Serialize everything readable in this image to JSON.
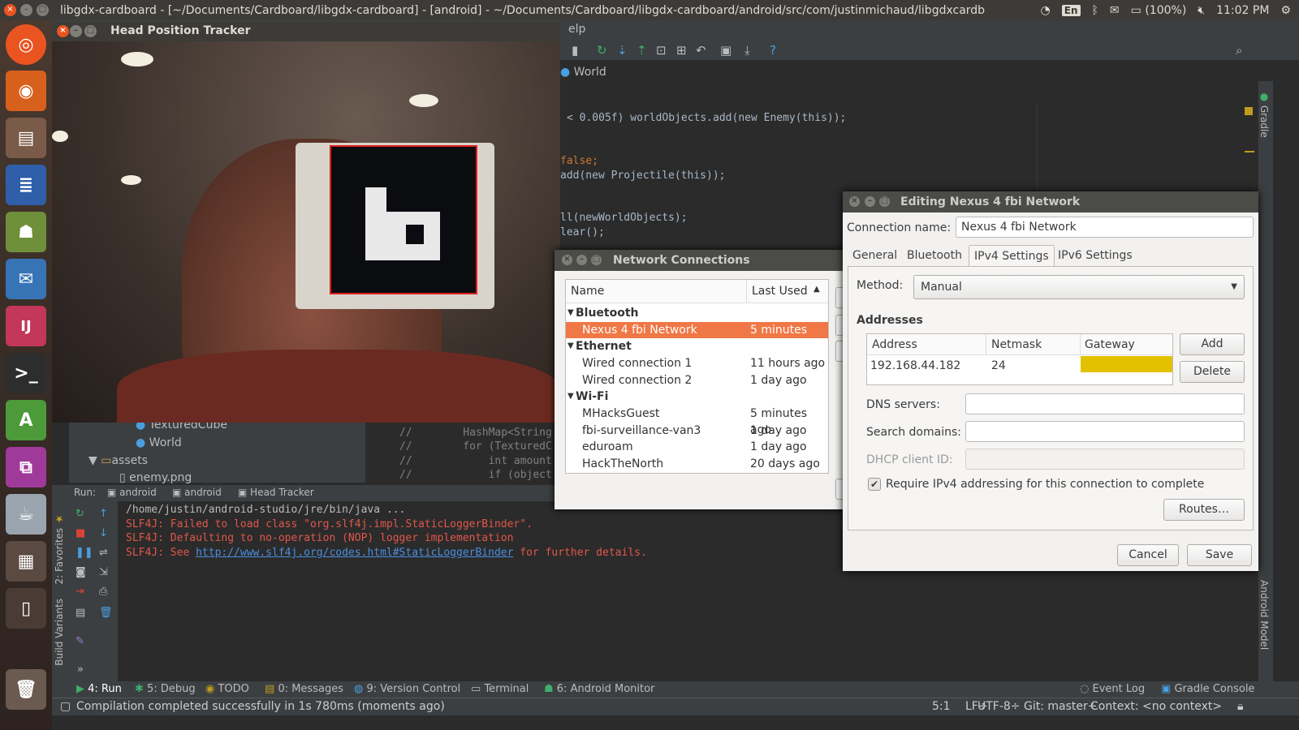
{
  "top_panel": {
    "title": "libgdx-cardboard - [~/Documents/Cardboard/libgdx-cardboard] - [android] - ~/Documents/Cardboard/libgdx-cardboard/android/src/com/justinmichaud/libgdxcardb",
    "lang": "En",
    "battery": "(100%)",
    "time": "11:02 PM"
  },
  "ide": {
    "menu_help": "elp",
    "breadcrumb": "World",
    "code_lines": [
      "< 0.005f) worldObjects.add(new Enemy(this));",
      "false;",
      "add(new Projectile(this));",
      "ll(newWorldObjects);",
      "lear();"
    ],
    "code_lines_lower": [
      "//        HashMap<String",
      "//        for (TexturedC",
      "//            int amount",
      "//            if (object"
    ],
    "project_tree": [
      "TexturedCube",
      "World",
      "assets",
      "enemy.png"
    ],
    "run_bar": {
      "label": "Run:",
      "tabs": [
        "android",
        "android",
        "Head Tracker"
      ]
    },
    "console_lines": [
      "/home/justin/android-studio/jre/bin/java ...",
      "SLF4J: Failed to load class \"org.slf4j.impl.StaticLoggerBinder\".",
      "SLF4J: Defaulting to no-operation (NOP) logger implementation",
      "SLF4J: See ",
      "http://www.slf4j.org/codes.html#StaticLoggerBinder",
      " for further details."
    ],
    "side_labels": {
      "gradle": "Gradle",
      "favorites": "2: Favorites",
      "build_variants": "Build Variants",
      "android_model": "Android Model"
    },
    "bottom_tabs": [
      "4: Run",
      "5: Debug",
      "TODO",
      "0: Messages",
      "9: Version Control",
      "Terminal",
      "6: Android Monitor"
    ],
    "bottom_right_tabs": [
      "Event Log",
      "Gradle Console"
    ],
    "status": {
      "message": "Compilation completed successfully in 1s 780ms (moments ago)",
      "position": "5:1",
      "line_sep": "LF÷",
      "encoding": "UTF-8÷",
      "git": "Git: master÷",
      "context": "Context: <no context>"
    }
  },
  "head_tracker": {
    "title": "Head Position Tracker"
  },
  "network_connections": {
    "title": "Network Connections",
    "columns": [
      "Name",
      "Last Used"
    ],
    "groups": [
      {
        "name": "Bluetooth",
        "items": [
          {
            "name": "Nexus 4 fbi Network",
            "last": "5 minutes ago",
            "selected": true
          }
        ]
      },
      {
        "name": "Ethernet",
        "items": [
          {
            "name": "Wired connection 1",
            "last": "11 hours ago"
          },
          {
            "name": "Wired connection 2",
            "last": "1 day ago"
          }
        ]
      },
      {
        "name": "Wi-Fi",
        "items": [
          {
            "name": "MHacksGuest",
            "last": "5 minutes ago"
          },
          {
            "name": "fbi-surveillance-van3",
            "last": "1 day ago"
          },
          {
            "name": "eduroam",
            "last": "1 day ago"
          },
          {
            "name": "HackTheNorth",
            "last": "20 days ago"
          }
        ]
      }
    ]
  },
  "edit_dialog": {
    "title": "Editing Nexus 4 fbi Network",
    "conn_name_label": "Connection name:",
    "conn_name_value": "Nexus 4 fbi Network",
    "tabs": [
      "General",
      "Bluetooth",
      "IPv4 Settings",
      "IPv6 Settings"
    ],
    "method_label": "Method:",
    "method_value": "Manual",
    "addresses_label": "Addresses",
    "addr_columns": [
      "Address",
      "Netmask",
      "Gateway"
    ],
    "addr_row": {
      "address": "192.168.44.182",
      "netmask": "24",
      "gateway": ""
    },
    "add_button": "Add",
    "delete_button": "Delete",
    "dns_label": "DNS servers:",
    "search_label": "Search domains:",
    "dhcp_label": "DHCP client ID:",
    "require_label": "Require IPv4 addressing for this connection to complete",
    "routes_button": "Routes…",
    "cancel_button": "Cancel",
    "save_button": "Save",
    "accent_gateway": "#e2c200"
  }
}
